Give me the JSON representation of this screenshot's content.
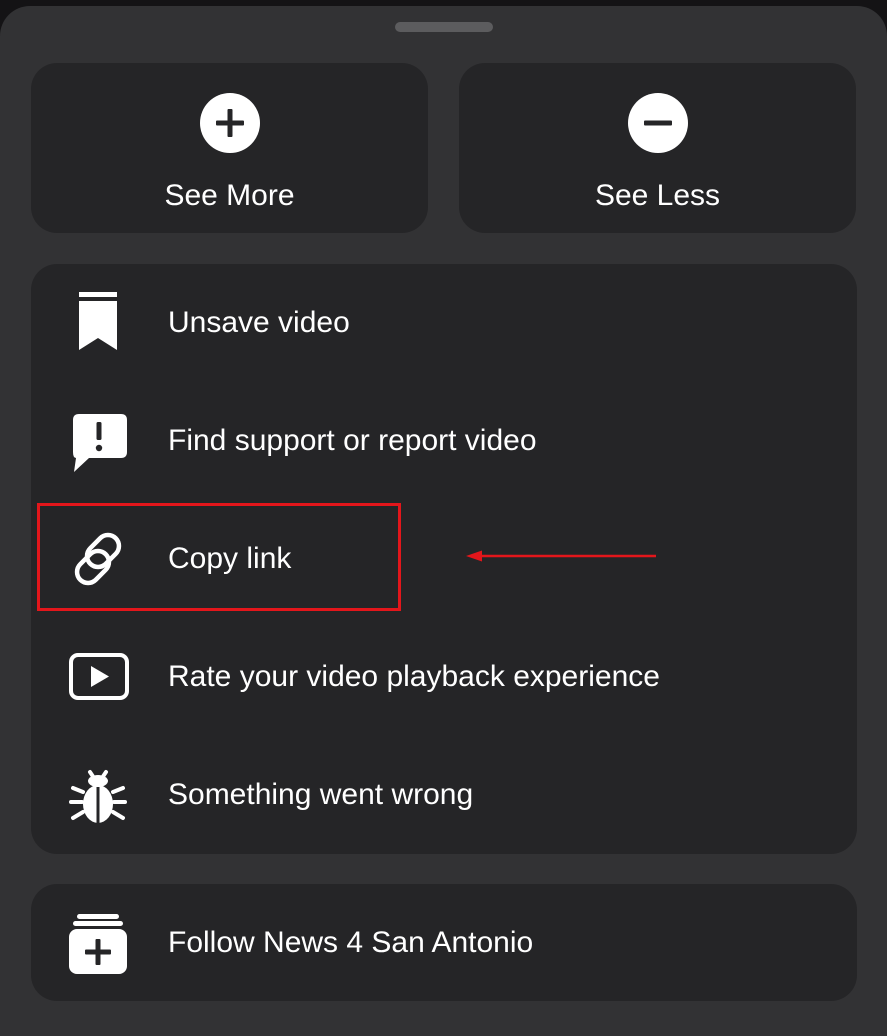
{
  "top_actions": {
    "see_more_label": "See More",
    "see_more_icon": "plus-circle-icon",
    "see_less_label": "See Less",
    "see_less_icon": "minus-circle-icon"
  },
  "menu": {
    "items": [
      {
        "label": "Unsave video",
        "icon": "bookmark-icon"
      },
      {
        "label": "Find support or report video",
        "icon": "report-icon"
      },
      {
        "label": "Copy link",
        "icon": "link-icon"
      },
      {
        "label": "Rate your video playback experience",
        "icon": "play-icon"
      },
      {
        "label": "Something went wrong",
        "icon": "bug-icon"
      }
    ]
  },
  "follow": {
    "label": "Follow News 4 San Antonio",
    "icon": "follow-page-icon"
  },
  "colors": {
    "sheet": "#323234",
    "card": "#252527",
    "text": "#ffffff",
    "annotation": "#e3161b"
  }
}
